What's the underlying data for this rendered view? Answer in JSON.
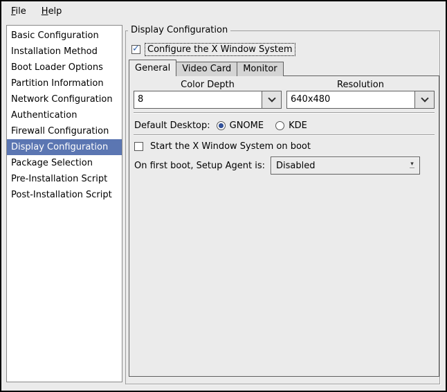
{
  "window_title": "Display Configuration",
  "colors": {
    "background": "#ebebeb",
    "selection_blue": "#5b76b2",
    "check_blue": "#3262a8",
    "radio_blue": "#31519b",
    "tab_inactive": "#d4d4d4",
    "widget_border": "#5f5f5f"
  },
  "icons": {
    "checkmark": "✓",
    "chevron_down": "v",
    "option_menu_arrow": "▾"
  },
  "menubar": {
    "file": {
      "u": "F",
      "rest": "ile"
    },
    "help": {
      "u": "H",
      "rest": "elp"
    }
  },
  "sidebar": {
    "selected_index": 7,
    "items": [
      "Basic Configuration",
      "Installation Method",
      "Boot Loader Options",
      "Partition Information",
      "Network Configuration",
      "Authentication",
      "Firewall Configuration",
      "Display Configuration",
      "Package Selection",
      "Pre-Installation Script",
      "Post-Installation Script"
    ]
  },
  "main": {
    "frame_title": "Display Configuration",
    "configure_x": {
      "label": "Configure the X Window System",
      "checked": true
    },
    "tabs": [
      {
        "label": "General",
        "active": true
      },
      {
        "label": "Video Card",
        "active": false
      },
      {
        "label": "Monitor",
        "active": false
      }
    ],
    "general": {
      "color_depth": {
        "label": "Color Depth",
        "value": "8"
      },
      "resolution": {
        "label": "Resolution",
        "value": "640x480"
      },
      "default_desktop": {
        "label": "Default Desktop:",
        "options": [
          {
            "label": "GNOME",
            "selected": true
          },
          {
            "label": "KDE",
            "selected": false
          }
        ]
      },
      "start_x": {
        "label": "Start the X Window System on boot",
        "checked": false
      },
      "setup_agent": {
        "label": "On first boot, Setup Agent is:",
        "value": "Disabled"
      }
    }
  }
}
